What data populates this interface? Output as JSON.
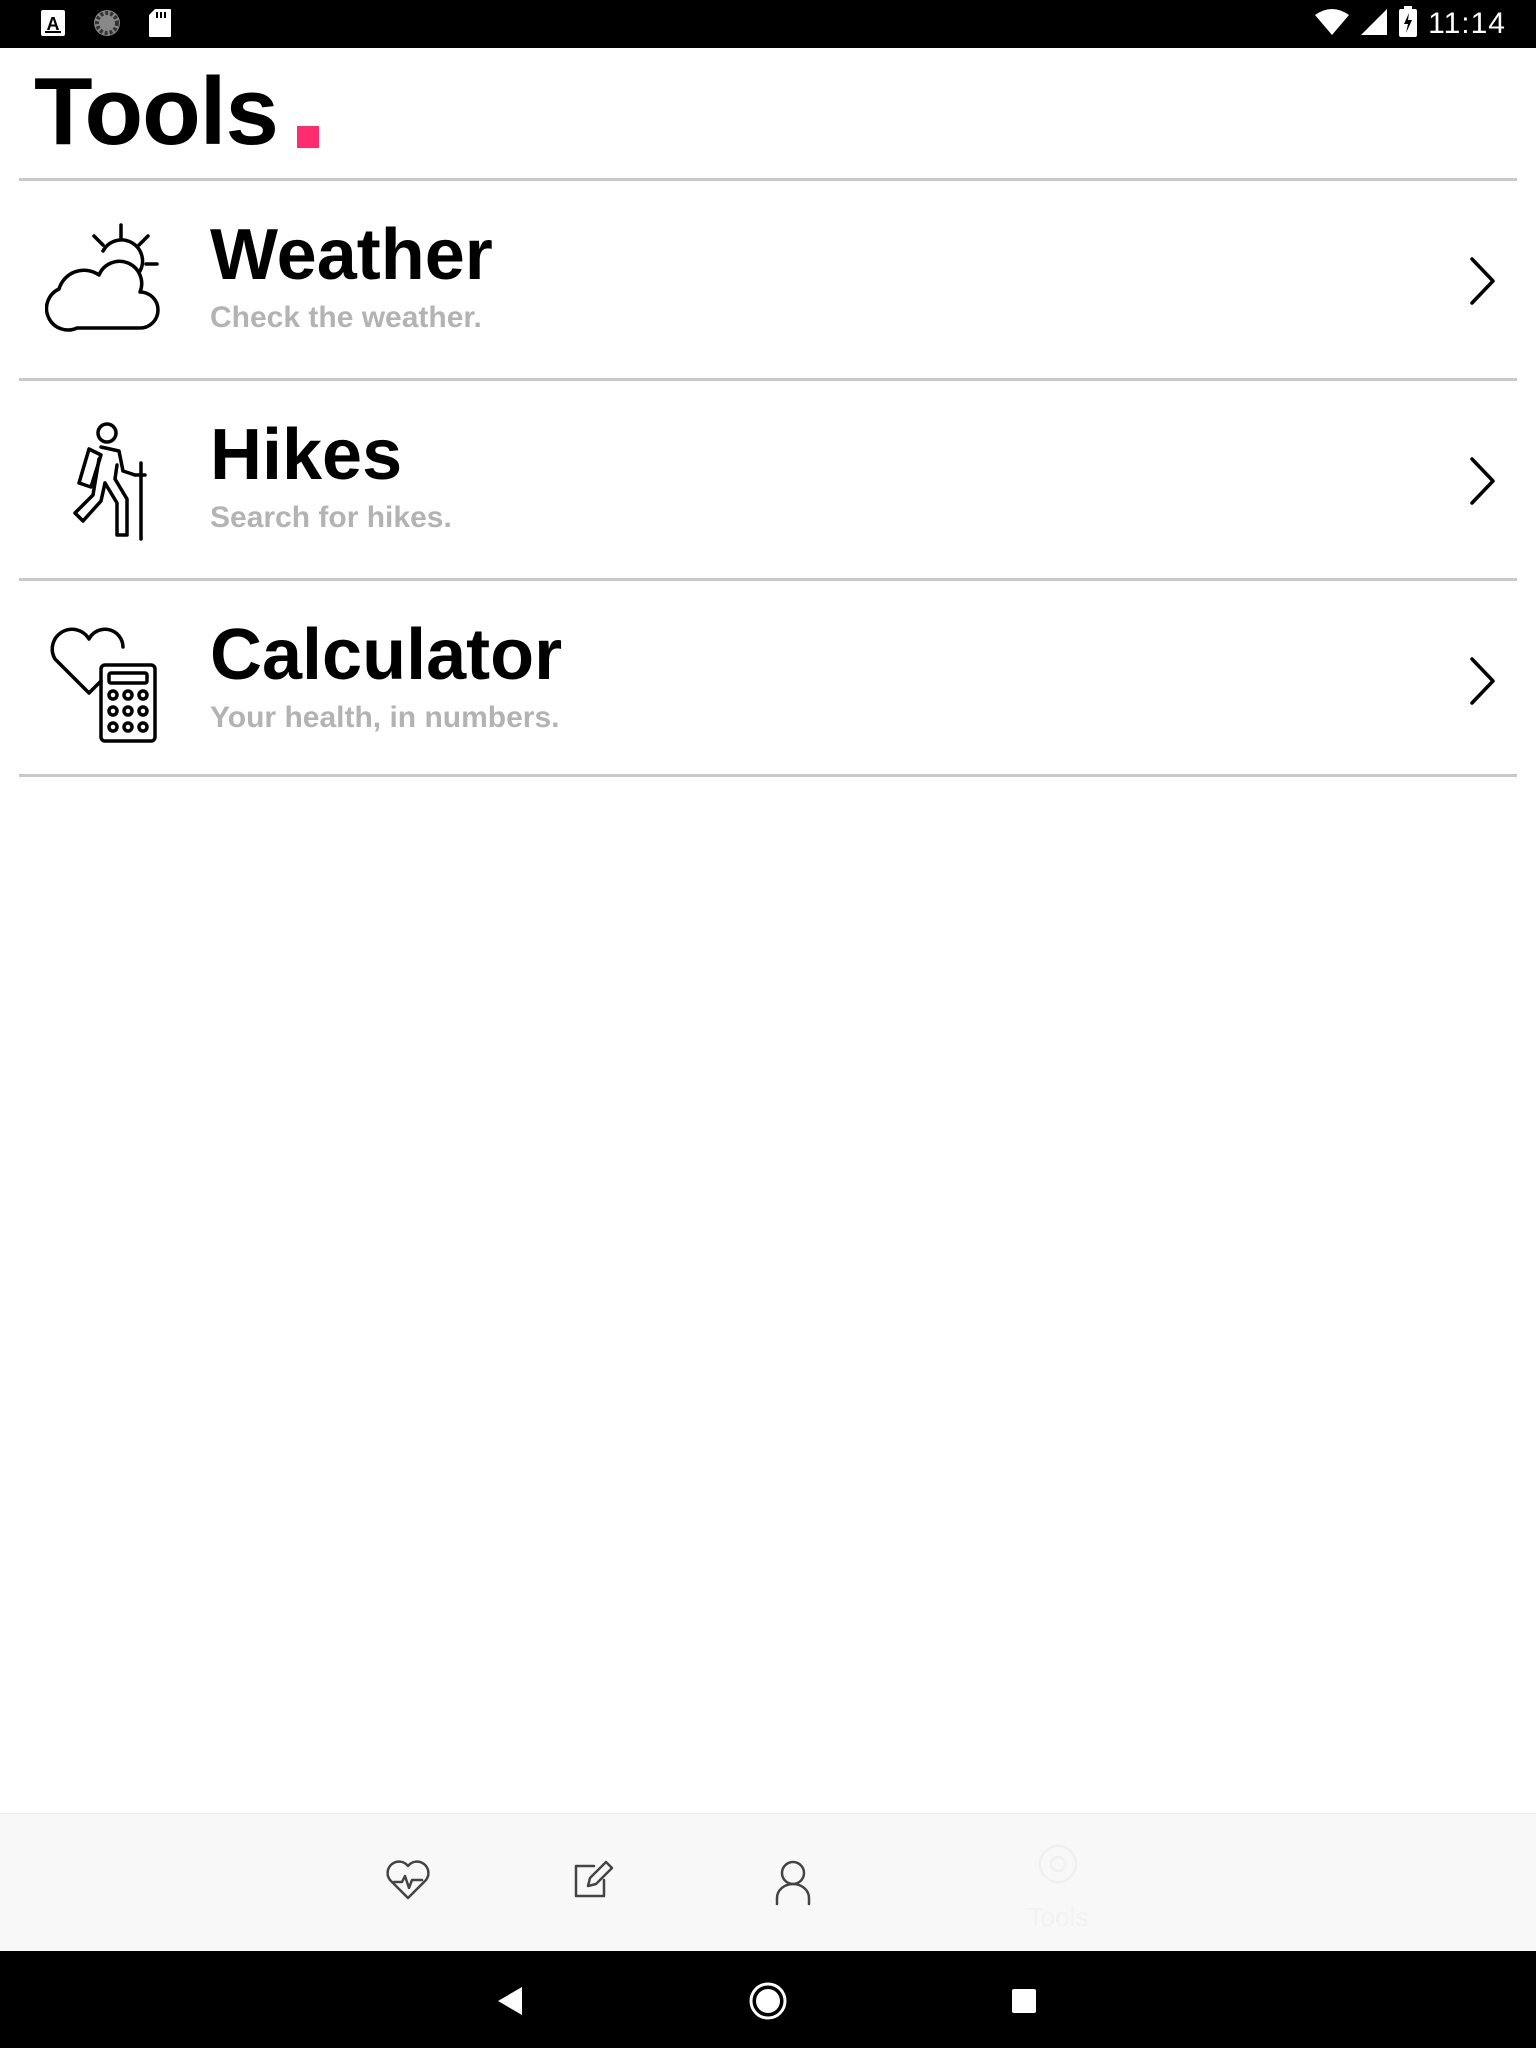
{
  "status_bar": {
    "time": "11:14",
    "icons": [
      "a-notification-icon",
      "sync-icon",
      "sd-card-icon",
      "wifi-icon",
      "signal-icon",
      "battery-charging-icon"
    ]
  },
  "header": {
    "title": "Tools",
    "accent_color": "#ff2d6f"
  },
  "tools": [
    {
      "name": "Weather",
      "description": "Check the weather.",
      "icon": "weather-icon"
    },
    {
      "name": "Hikes",
      "description": "Search for hikes.",
      "icon": "hiker-icon"
    },
    {
      "name": "Calculator",
      "description": "Your health, in numbers.",
      "icon": "health-calculator-icon"
    }
  ],
  "bottom_nav": {
    "items": [
      {
        "icon": "heart-pulse-icon"
      },
      {
        "icon": "edit-note-icon"
      },
      {
        "icon": "profile-icon"
      },
      {
        "icon": "tools-icon",
        "label": "Tools",
        "active": true
      }
    ]
  },
  "system_nav": {
    "buttons": [
      "back-icon",
      "home-icon",
      "recents-icon"
    ]
  },
  "colors": {
    "description_text": "#b3b3b3",
    "divider": "#c8c8c8",
    "bottom_nav_bg": "#f8f8f8"
  }
}
